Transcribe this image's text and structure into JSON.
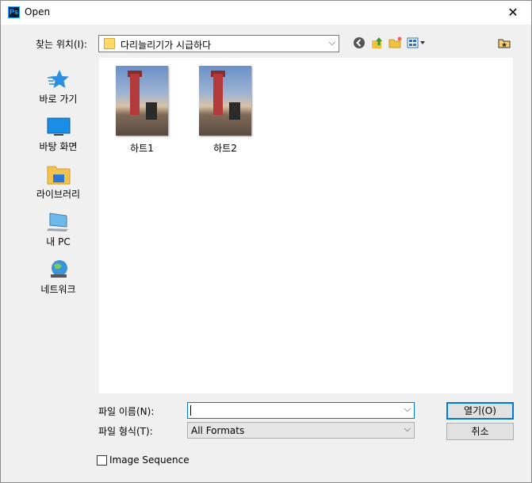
{
  "window": {
    "title": "Open",
    "app_icon": "Ps"
  },
  "lookin": {
    "label": "찾는 위치(I):",
    "value": "다리늘리기가 시급하다"
  },
  "places": [
    {
      "label": "바로 가기",
      "icon": "star-icon"
    },
    {
      "label": "바탕 화면",
      "icon": "desktop-icon"
    },
    {
      "label": "라이브러리",
      "icon": "library-folder-icon"
    },
    {
      "label": "내 PC",
      "icon": "computer-icon"
    },
    {
      "label": "네트워크",
      "icon": "network-globe-icon"
    }
  ],
  "files": [
    {
      "name": "하트1"
    },
    {
      "name": "하트2"
    }
  ],
  "filename": {
    "label": "파일 이름(N):",
    "value": ""
  },
  "filetype": {
    "label": "파일 형식(T):",
    "value": "All Formats"
  },
  "buttons": {
    "open": "열기(O)",
    "cancel": "취소"
  },
  "image_sequence": {
    "label": "Image Sequence",
    "checked": false
  }
}
